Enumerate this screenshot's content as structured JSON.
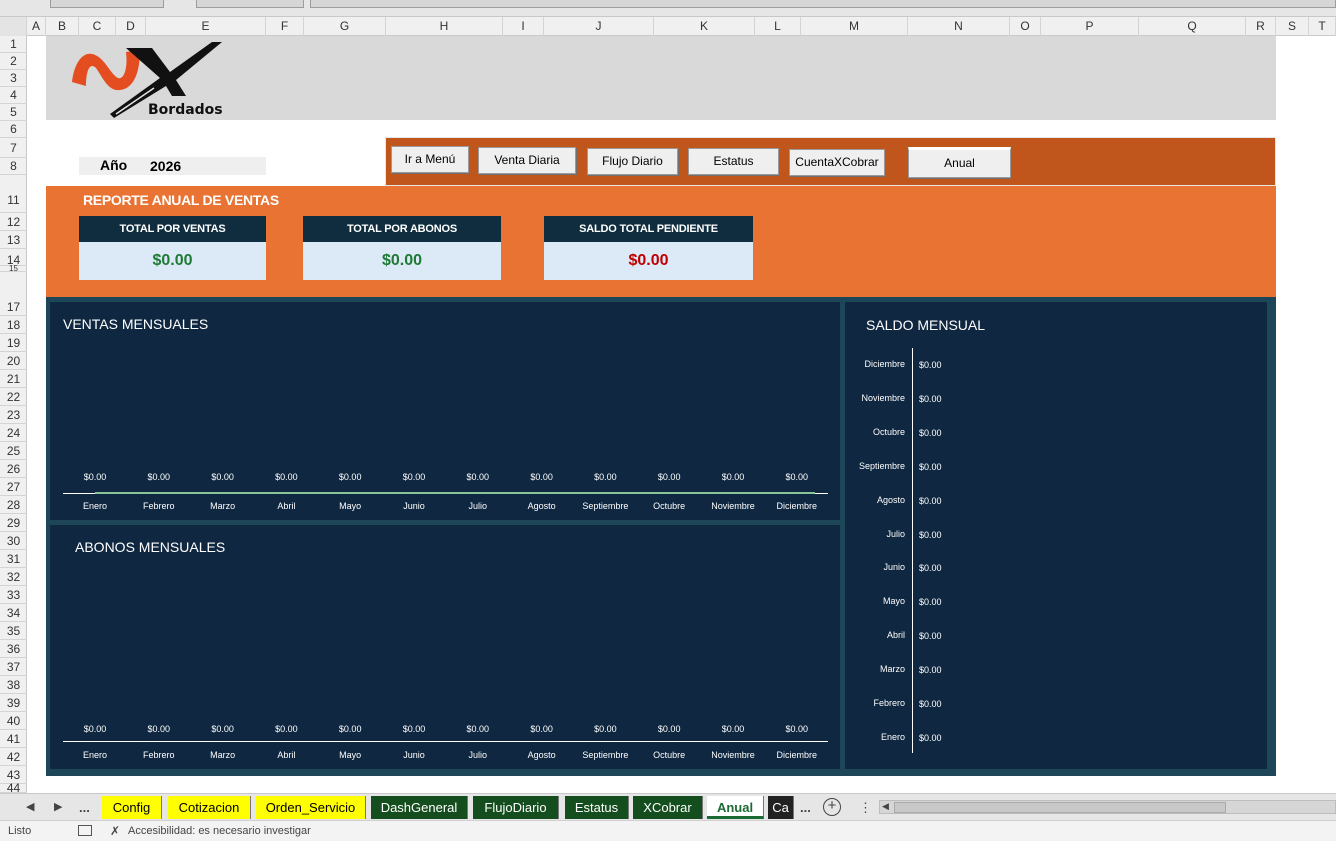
{
  "columns": [
    "A",
    "B",
    "C",
    "D",
    "E",
    "F",
    "G",
    "H",
    "I",
    "J",
    "K",
    "L",
    "M",
    "N",
    "O",
    "P",
    "Q",
    "R",
    "S",
    "T"
  ],
  "rows": [
    "1",
    "2",
    "3",
    "4",
    "5",
    "6",
    "7",
    "8",
    "11",
    "12",
    "13",
    "14",
    "15",
    "17",
    "18",
    "19",
    "20",
    "21",
    "22",
    "23",
    "24",
    "25",
    "26",
    "27",
    "28",
    "29",
    "30",
    "31",
    "32",
    "33",
    "34",
    "35",
    "36",
    "37",
    "38",
    "39",
    "40",
    "41",
    "42",
    "43",
    "44"
  ],
  "logo": {
    "brand": "NX",
    "subtitle": "Bordados"
  },
  "year": {
    "label": "Año",
    "value": "2026"
  },
  "nav_buttons": [
    "Ir a Menú",
    "Venta Diaria",
    "Flujo Diario",
    "Estatus",
    "CuentaXCobrar",
    "Anual"
  ],
  "report": {
    "title": "REPORTE ANUAL DE VENTAS",
    "kpis": [
      {
        "label": "TOTAL POR VENTAS",
        "value": "$0.00",
        "color": "#1e7a35"
      },
      {
        "label": "TOTAL POR ABONOS",
        "value": "$0.00",
        "color": "#1e7a35"
      },
      {
        "label": "SALDO TOTAL PENDIENTE",
        "value": "$0.00",
        "color": "#c00000"
      }
    ]
  },
  "charts": {
    "ventas_title": "VENTAS MENSUALES",
    "abonos_title": "ABONOS MENSUALES",
    "saldo_title": "SALDO MENSUAL"
  },
  "chart_data": [
    {
      "type": "bar",
      "title": "VENTAS MENSUALES",
      "categories": [
        "Enero",
        "Febrero",
        "Marzo",
        "Abril",
        "Mayo",
        "Junio",
        "Julio",
        "Agosto",
        "Septiembre",
        "Octubre",
        "Noviembre",
        "Diciembre"
      ],
      "values": [
        0,
        0,
        0,
        0,
        0,
        0,
        0,
        0,
        0,
        0,
        0,
        0
      ],
      "data_labels": [
        "$0.00",
        "$0.00",
        "$0.00",
        "$0.00",
        "$0.00",
        "$0.00",
        "$0.00",
        "$0.00",
        "$0.00",
        "$0.00",
        "$0.00",
        "$0.00"
      ]
    },
    {
      "type": "bar",
      "title": "ABONOS MENSUALES",
      "categories": [
        "Enero",
        "Febrero",
        "Marzo",
        "Abril",
        "Mayo",
        "Junio",
        "Julio",
        "Agosto",
        "Septiembre",
        "Octubre",
        "Noviembre",
        "Diciembre"
      ],
      "values": [
        0,
        0,
        0,
        0,
        0,
        0,
        0,
        0,
        0,
        0,
        0,
        0
      ],
      "data_labels": [
        "$0.00",
        "$0.00",
        "$0.00",
        "$0.00",
        "$0.00",
        "$0.00",
        "$0.00",
        "$0.00",
        "$0.00",
        "$0.00",
        "$0.00",
        "$0.00"
      ]
    },
    {
      "type": "bar",
      "orientation": "horizontal",
      "title": "SALDO MENSUAL",
      "categories": [
        "Diciembre",
        "Noviembre",
        "Octubre",
        "Septiembre",
        "Agosto",
        "Julio",
        "Junio",
        "Mayo",
        "Abril",
        "Marzo",
        "Febrero",
        "Enero"
      ],
      "values": [
        0,
        0,
        0,
        0,
        0,
        0,
        0,
        0,
        0,
        0,
        0,
        0
      ],
      "data_labels": [
        "$0.00",
        "$0.00",
        "$0.00",
        "$0.00",
        "$0.00",
        "$0.00",
        "$0.00",
        "$0.00",
        "$0.00",
        "$0.00",
        "$0.00",
        "$0.00"
      ]
    }
  ],
  "sheet_tabs": [
    {
      "label": "Config",
      "style": "yellow"
    },
    {
      "label": "Cotizacion",
      "style": "yellow"
    },
    {
      "label": "Orden_Servicio",
      "style": "yellow"
    },
    {
      "label": "DashGeneral",
      "style": "green"
    },
    {
      "label": "FlujoDiario",
      "style": "green"
    },
    {
      "label": "Estatus",
      "style": "green"
    },
    {
      "label": "XCobrar",
      "style": "green"
    },
    {
      "label": "Anual",
      "style": "active"
    },
    {
      "label": "Ca",
      "style": "black"
    }
  ],
  "tab_nav": {
    "ellipsis": "...",
    "add": "+",
    "more": "⋮"
  },
  "status": {
    "ready": "Listo",
    "accessibility": "Accesibilidad: es necesario investigar"
  },
  "colors": {
    "orange": "#e97332",
    "menu": "#c0561b",
    "navy": "#0f2740",
    "frame": "#1d4659"
  }
}
